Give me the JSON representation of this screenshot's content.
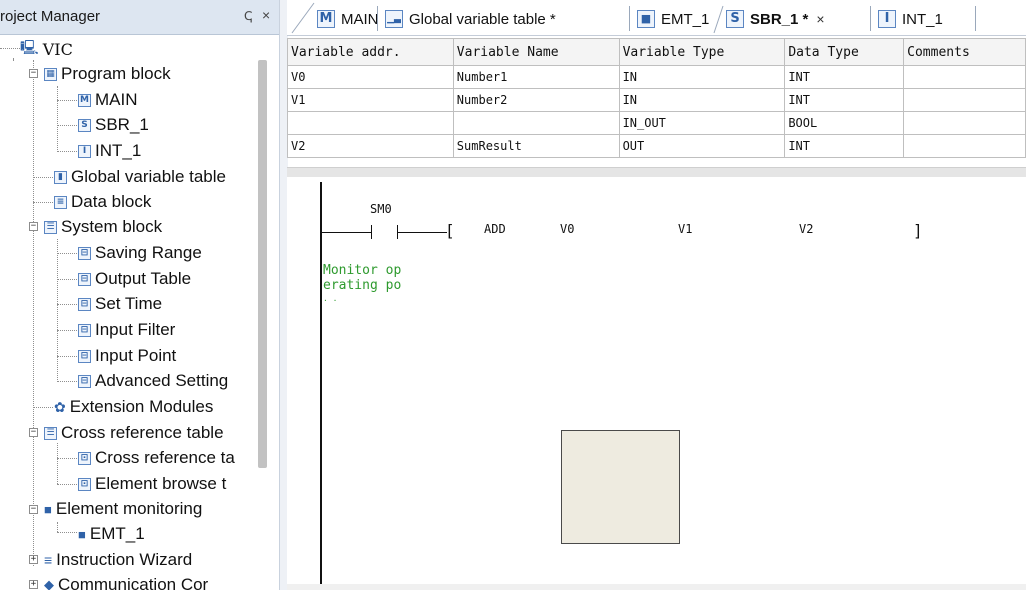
{
  "project_manager": {
    "title": "roject Manager",
    "pin_glyph": "ↅ",
    "close_glyph": "×",
    "tree": [
      {
        "key": "vic",
        "label": "VIC",
        "icon": "plc-station-icon"
      },
      {
        "key": "program_block",
        "label": "Program block",
        "icon": "program-block-icon",
        "expanded": true
      },
      {
        "key": "main",
        "label": "MAIN",
        "icon": "main-program-icon",
        "glyph": "M"
      },
      {
        "key": "sbr_1",
        "label": "SBR_1",
        "icon": "subroutine-icon",
        "glyph": "S"
      },
      {
        "key": "int_1",
        "label": "INT_1",
        "icon": "interrupt-icon",
        "glyph": "I"
      },
      {
        "key": "global_var_table",
        "label": "Global variable table",
        "icon": "table-icon"
      },
      {
        "key": "data_block",
        "label": "Data block",
        "icon": "data-block-icon"
      },
      {
        "key": "system_block",
        "label": "System block",
        "icon": "system-block-icon",
        "expanded": true
      },
      {
        "key": "saving_range",
        "label": "Saving Range",
        "icon": "setting-item-icon"
      },
      {
        "key": "output_table",
        "label": "Output Table",
        "icon": "setting-item-icon"
      },
      {
        "key": "set_time",
        "label": "Set Time",
        "icon": "setting-item-icon"
      },
      {
        "key": "input_filter",
        "label": "Input Filter",
        "icon": "setting-item-icon"
      },
      {
        "key": "input_point",
        "label": "Input Point",
        "icon": "setting-item-icon"
      },
      {
        "key": "advanced_setting",
        "label": "Advanced Setting",
        "icon": "setting-item-icon"
      },
      {
        "key": "extension_modules",
        "label": "Extension Modules",
        "icon": "gear-icon"
      },
      {
        "key": "cross_ref_table",
        "label": "Cross reference table",
        "icon": "list-icon",
        "expanded": true
      },
      {
        "key": "cross_ref_ta",
        "label": "Cross reference ta",
        "icon": "cross-ref-icon"
      },
      {
        "key": "element_browse",
        "label": "Element browse t",
        "icon": "cross-ref-icon"
      },
      {
        "key": "element_monitoring",
        "label": "Element monitoring",
        "icon": "monitor-icon",
        "expanded": true
      },
      {
        "key": "emt_1",
        "label": "EMT_1",
        "icon": "monitor-icon"
      },
      {
        "key": "instruction_wizard",
        "label": "Instruction Wizard",
        "icon": "wizard-icon",
        "expanded": false
      },
      {
        "key": "communication",
        "label": "Communication Cor",
        "icon": "communication-icon",
        "expanded": false
      }
    ]
  },
  "tabs": [
    {
      "label": "MAIN",
      "icon": "main-program-icon",
      "glyph": "M",
      "active": false
    },
    {
      "label": "Global variable table *",
      "icon": "table-icon",
      "glyph": "▁▃",
      "active": false
    },
    {
      "label": "EMT_1",
      "icon": "monitor-icon",
      "glyph": "■",
      "active": false
    },
    {
      "label": "SBR_1 *",
      "icon": "subroutine-icon",
      "glyph": "S",
      "active": true,
      "close": "×"
    },
    {
      "label": "INT_1",
      "icon": "interrupt-icon",
      "glyph": "I",
      "active": false
    }
  ],
  "variable_table": {
    "columns": [
      "Variable addr.",
      "Variable Name",
      "Variable Type",
      "Data Type",
      "Comments"
    ],
    "rows": [
      [
        "V0",
        "Number1",
        "IN",
        "INT",
        ""
      ],
      [
        "V1",
        "Number2",
        "IN",
        "INT",
        ""
      ],
      [
        "",
        "",
        "IN_OUT",
        "BOOL",
        ""
      ],
      [
        "V2",
        "SumResult",
        "OUT",
        "INT",
        ""
      ]
    ]
  },
  "ladder": {
    "contact_label": "SM0",
    "instruction": "ADD",
    "operands": [
      "V0",
      "V1",
      "V2"
    ],
    "open_bracket": "[",
    "close_bracket": "]",
    "comment_lines": [
      "Monitor op",
      "erating po"
    ]
  },
  "colors": {
    "header_bg": "#dde6f1",
    "comment_green": "#2e9a2e",
    "tooltip_bg": "#eeebe0"
  }
}
